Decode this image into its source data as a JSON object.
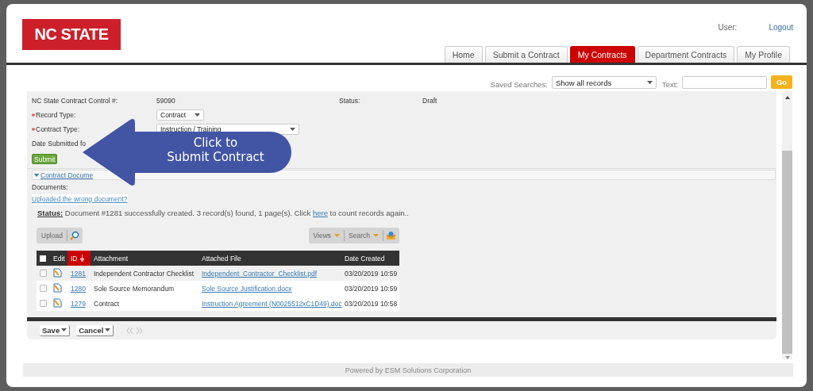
{
  "header": {
    "logo": "NC STATE",
    "user_label": "User:",
    "logout": "Logout"
  },
  "tabs": [
    {
      "label": "Home",
      "selected": false
    },
    {
      "label": "Submit a Contract",
      "selected": false
    },
    {
      "label": "My Contracts",
      "selected": true
    },
    {
      "label": "Department Contracts",
      "selected": false
    },
    {
      "label": "My Profile",
      "selected": false
    }
  ],
  "search_bar": {
    "saved_searches_label": "Saved Searches:",
    "saved_search_value": "Show all records",
    "text_label": "Text:",
    "go_button": "Go"
  },
  "form": {
    "fields": [
      {
        "label": "NC State Contract Control #:",
        "required": false,
        "kind": "text",
        "value": "59090"
      },
      {
        "label": "Record Type:",
        "required": true,
        "kind": "select",
        "value": "Contract"
      },
      {
        "label": "Contract Type:",
        "required": true,
        "kind": "select",
        "value": "Instruction / Training"
      },
      {
        "label": "Date Submitted fo",
        "required": false,
        "kind": "text"
      }
    ],
    "status_label": "Status:",
    "status_value": "Draft",
    "submit_button": "Submit"
  },
  "documents_section": {
    "title": "Contract Docume",
    "expanded": true,
    "documents_label": "Documents:",
    "wrong_document_link": "Uploaded the wrong document?"
  },
  "status_message": {
    "text": "**Status:** Document #1281 successfully created. 3 record(s) found, 1 page(s). Click ",
    "link": "here",
    "suffix": " to count records again.."
  },
  "toolbar": {
    "upload_button": "Upload",
    "views_button": "Views",
    "search_button": "Search"
  },
  "table": {
    "select_all_checked": false,
    "columns": [
      {
        "label": "Edit",
        "sorted": false
      },
      {
        "label": "ID",
        "sorted": true
      },
      {
        "label": "Attachment",
        "sorted": false
      },
      {
        "label": "Attached File",
        "sorted": false
      },
      {
        "label": "Date Created",
        "sorted": false
      }
    ],
    "rows": [
      {
        "id": "1281",
        "attachment": "Independent Contractor Checklist",
        "file": "Independent_Contractor_Checklist.pdf",
        "date": "03/20/2019 10:59",
        "checked": false,
        "selected": true
      },
      {
        "id": "1280",
        "attachment": "Sole Source Memorandum",
        "file": "Sole Source Justification.docx",
        "date": "03/20/2019 10:59",
        "checked": false,
        "selected": false
      },
      {
        "id": "1279",
        "attachment": "Contract",
        "file": "Instruction Agreement (N0025512xC1D49).doc",
        "date": "03/20/2019 10:58",
        "checked": false,
        "selected": false
      }
    ]
  },
  "form_buttons": {
    "save": "Save",
    "cancel": "Cancel"
  },
  "callout": {
    "text": "Click to\nSubmit Contract"
  },
  "footer": "Powered by ESM Solutions Corporation"
}
